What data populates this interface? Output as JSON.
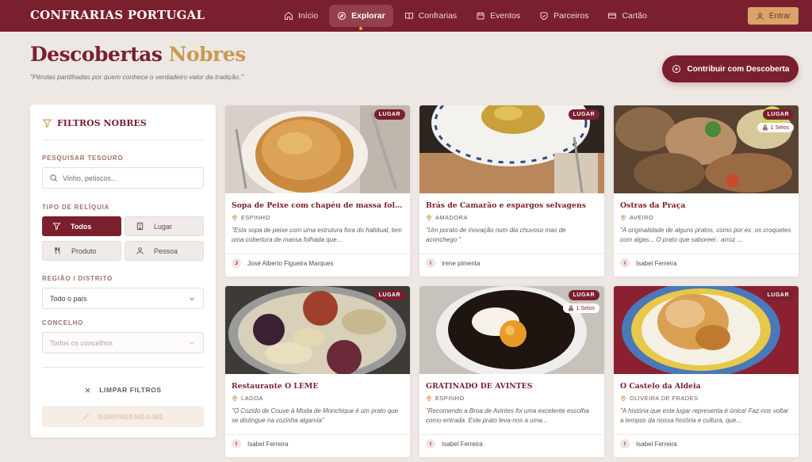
{
  "brand": "CONFRARIAS PORTUGAL",
  "nav": [
    {
      "label": "Início",
      "icon": "home-icon",
      "active": false
    },
    {
      "label": "Explorar",
      "icon": "compass-icon",
      "active": true
    },
    {
      "label": "Confrarias",
      "icon": "book-icon",
      "active": false
    },
    {
      "label": "Eventos",
      "icon": "calendar-icon",
      "active": false
    },
    {
      "label": "Parceiros",
      "icon": "badge-icon",
      "active": false
    },
    {
      "label": "Cartão",
      "icon": "card-icon",
      "active": false
    }
  ],
  "login_label": "Entrar",
  "title_main": "Descobertas",
  "title_accent": "Nobres",
  "subtitle": "\"Pérolas partilhadas por quem conhece o verdadeiro valor da tradição.\"",
  "contribute_label": "Contribuir com Descoberta",
  "filters": {
    "heading": "FILTROS NOBRES",
    "search_label": "PESQUISAR TESOURO",
    "search_placeholder": "Vinho, petiscos...",
    "type_label": "TIPO DE RELÍQUIA",
    "types": [
      {
        "label": "Todos",
        "icon": "filter-icon",
        "active": true
      },
      {
        "label": "Lugar",
        "icon": "building-icon",
        "active": false
      },
      {
        "label": "Produto",
        "icon": "utensils-icon",
        "active": false
      },
      {
        "label": "Pessoa",
        "icon": "person-icon",
        "active": false
      }
    ],
    "region_label": "REGIÃO / DISTRITO",
    "region_value": "Todo o país",
    "county_label": "CONCELHO",
    "county_value": "Todos os concelhos",
    "clear_label": "LIMPAR FILTROS",
    "surprise_label": "SURPREENDA-ME"
  },
  "cards": [
    {
      "badge": "LUGAR",
      "seals": "",
      "title": "Sopa de Peixe com chapéu de massa folhada...",
      "location": "ESPINHO",
      "quote": "\"Esta sopa de peixe com uma estrutura fora do habitual, tem uma cobertura de massa folhada que...",
      "author": "José Alberto Figueira Marques",
      "initial": "J"
    },
    {
      "badge": "LUGAR",
      "seals": "",
      "title": "Brás de Camarão e espargos selvagens",
      "location": "AMADORA",
      "quote": "\"Um porato de inovação num dia chuvoso mas de aconchego \"",
      "author": "irene pimenta",
      "initial": "i"
    },
    {
      "badge": "LUGAR",
      "seals": "1 Selos",
      "title": "Ostras da Praça",
      "location": "AVEIRO",
      "quote": "\"A originalidade de alguns pratos, como por ex. os croquetes com algas... O prato que saboreei : arroz ...",
      "author": "Isabel Ferreira",
      "initial": "I"
    },
    {
      "badge": "LUGAR",
      "seals": "",
      "title": "Restaurante O LEME",
      "location": "LAGOA",
      "quote": "\"O Cozido de Couve à Moda de Monchique é um prato que se distingue na cozinha algarvia\"",
      "author": "Isabel Ferreira",
      "initial": "I"
    },
    {
      "badge": "LUGAR",
      "seals": "1 Selos",
      "title": "GRATINADO DE AVINTES",
      "location": "ESPINHO",
      "quote": "\"Recomendo a Broa de Avintes foi uma excelente escolha como entrada. Este prato leva-nos a uma...",
      "author": "Isabel Ferreira",
      "initial": "I"
    },
    {
      "badge": "LUGAR",
      "seals": "",
      "title": "O Castelo da Aldeia",
      "location": "OLIVEIRA DE FRADES",
      "quote": "\"A história que este lugar representa é única! Faz-nos voltar a tempos da nossa história e cultura, que...",
      "author": "Isabel Ferreira",
      "initial": "I"
    }
  ]
}
